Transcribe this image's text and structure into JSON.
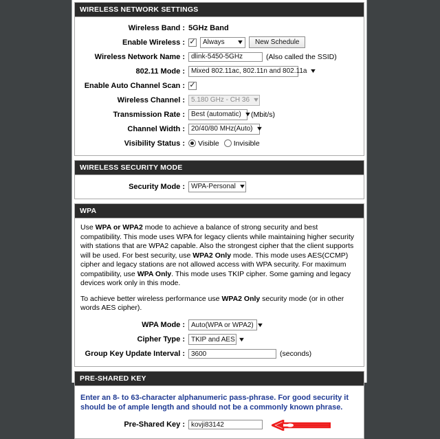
{
  "sections": {
    "network": {
      "title": "WIRELESS NETWORK SETTINGS",
      "rows": {
        "band_label": "Wireless Band :",
        "band_value": "5GHz Band",
        "enable_label": "Enable Wireless :",
        "enable_checked": "✓",
        "schedule_value": "Always",
        "schedule_button": "New Schedule",
        "ssid_label": "Wireless Network Name :",
        "ssid_value": "dlink-5450-5GHz",
        "ssid_hint": "(Also called the SSID)",
        "mode_label": "802.11 Mode :",
        "mode_value": "Mixed 802.11ac, 802.11n and 802.11a",
        "autoscan_label": "Enable Auto Channel Scan :",
        "autoscan_checked": "✓",
        "channel_label": "Wireless Channel :",
        "channel_value": "5.180 GHz - CH 36",
        "rate_label": "Transmission Rate :",
        "rate_value": "Best (automatic)",
        "rate_units": "(Mbit/s)",
        "width_label": "Channel Width :",
        "width_value": "20/40/80 MHz(Auto)",
        "visibility_label": "Visibility Status :",
        "visible_option": "Visible",
        "invisible_option": "Invisible"
      }
    },
    "security": {
      "title": "WIRELESS SECURITY MODE",
      "mode_label": "Security Mode :",
      "mode_value": "WPA-Personal"
    },
    "wpa": {
      "title": "WPA",
      "paragraph1_a": "Use ",
      "paragraph1_b": "WPA or WPA2",
      "paragraph1_c": " mode to achieve a balance of strong security and best compatibility. This mode uses WPA for legacy clients while maintaining higher security with stations that are WPA2 capable. Also the strongest cipher that the client supports will be used. For best security, use ",
      "paragraph1_d": "WPA2 Only",
      "paragraph1_e": " mode. This mode uses AES(CCMP) cipher and legacy stations are not allowed access with WPA security. For maximum compatibility, use ",
      "paragraph1_f": "WPA Only",
      "paragraph1_g": ". This mode uses TKIP cipher. Some gaming and legacy devices work only in this mode.",
      "paragraph2_a": "To achieve better wireless performance use ",
      "paragraph2_b": "WPA2 Only",
      "paragraph2_c": " security mode (or in other words AES cipher).",
      "wpa_mode_label": "WPA Mode :",
      "wpa_mode_value": "Auto(WPA or WPA2)",
      "cipher_label": "Cipher Type :",
      "cipher_value": "TKIP and AES",
      "gkui_label": "Group Key Update Interval :",
      "gkui_value": "3600",
      "gkui_units": "(seconds)"
    },
    "psk": {
      "title": "PRE-SHARED KEY",
      "note": "Enter an 8- to 63-character alphanumeric pass-phrase. For good security it should be of ample length and should not be a commonly known phrase.",
      "key_label": "Pre-Shared Key :",
      "key_value": "kovji83142"
    }
  },
  "icons": {
    "caret": "▼"
  },
  "colors": {
    "page_background": "#3e4244",
    "panel_header_background": "#2b2b2b",
    "panel_background": "#ffffff",
    "note_text": "#1f3a93",
    "annotation_arrow": "#ee1c1c"
  }
}
